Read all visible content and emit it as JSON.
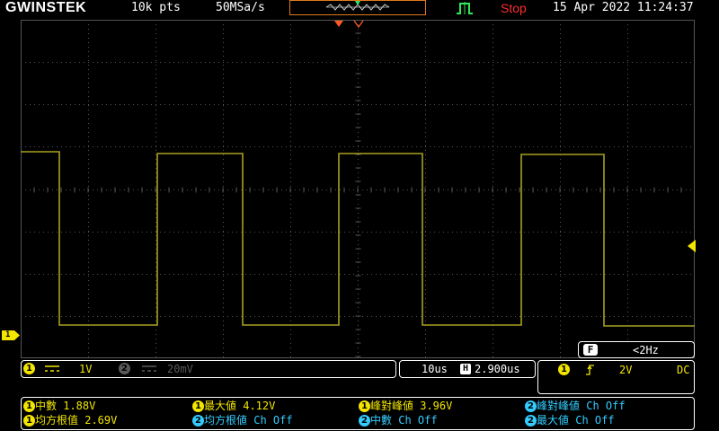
{
  "top": {
    "logo": "GWINSTEK",
    "memory": "10k pts",
    "sample_rate": "50MSa/s",
    "status": "Stop",
    "datetime": "15 Apr 2022 11:24:37"
  },
  "channel": {
    "ch1_num": "1",
    "ch1_scale": "1V",
    "ch2_num": "2",
    "ch2_scale": "20mV",
    "marker_label": "1"
  },
  "timebase": {
    "scale": "10us",
    "h_badge": "H",
    "position": "2.900us"
  },
  "trigger": {
    "source": "1",
    "level": "2V",
    "coupling": "DC"
  },
  "frequency": {
    "badge": "F",
    "value": "<2Hz"
  },
  "measurements": [
    {
      "ch": "1",
      "text": "中數 1.88V"
    },
    {
      "ch": "1",
      "text": "最大値 4.12V"
    },
    {
      "ch": "1",
      "text": "峰對峰値 3.96V"
    },
    {
      "ch": "2",
      "text": "峰對峰値 Ch Off"
    },
    {
      "ch": "1",
      "text": "均方根值 2.69V"
    },
    {
      "ch": "2",
      "text": "均方根値 Ch Off"
    },
    {
      "ch": "2",
      "text": "中數 Ch Off"
    },
    {
      "ch": "2",
      "text": "最大値 Ch Off"
    }
  ],
  "colors": {
    "ch1": "#f2e600",
    "ch2": "#33ccff",
    "trace": "#a8a020",
    "stop": "#ff2e2e",
    "overview_border": "#e07b1f",
    "trigger_mode": "#2ee85a",
    "grid": "#555555"
  },
  "icons": {
    "trigger_mode": "trigger-edge-mode-icon",
    "trigger_slope": "rising-edge-icon",
    "ch1_coupling": "dc-coupling-icon"
  }
}
